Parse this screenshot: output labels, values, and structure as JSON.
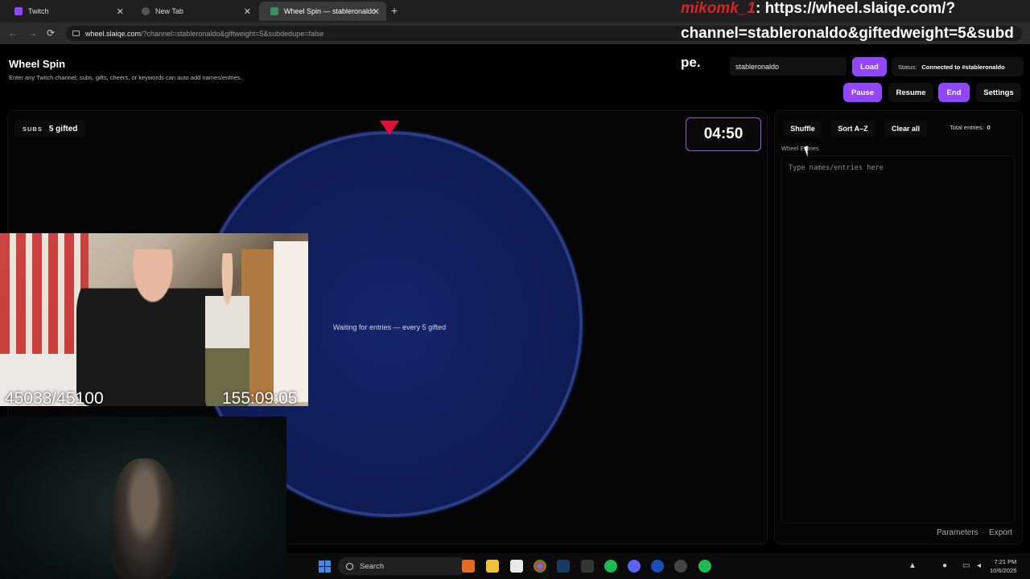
{
  "browser": {
    "tabs": [
      {
        "label": "Twitch",
        "active": false
      },
      {
        "label": "New Tab",
        "active": false
      },
      {
        "label": "Wheel Spin — stableronaldo",
        "active": true
      }
    ],
    "new_tab_symbol": "+",
    "close_symbol": "✕",
    "url_host": "wheel.slaiqe.com",
    "url_rest": "/?channel=stableronaldo&giftweight=5&subdedupe=false",
    "nav": {
      "back": "←",
      "forward": "→",
      "reload": "⟳"
    }
  },
  "overlay": {
    "username": "mikomk_1",
    "colon": ":",
    "url_line1": "https://wheel.slaiqe.com/?",
    "url_line2": "channel=stableronaldo&giftedweight=5&subd"
  },
  "app": {
    "title": "Wheel Spin",
    "subtitle": "Enter any Twitch channel; subs, gifts, cheers, or keywords can auto add names/entries.",
    "brand": "pe.",
    "channel_value": "stableronaldo",
    "load_label": "Load",
    "status_label": "Status:",
    "status_value": "Connected to #stableronaldo",
    "pause_label": "Pause",
    "resume_label": "Resume",
    "end_label": "End",
    "settings_label": "Settings"
  },
  "wheel": {
    "subs_label": "SUBS",
    "subs_value": "5 gifted",
    "timer": "04:50",
    "message": "Waiting for entries — every 5 gifted",
    "colors": {
      "wheel": "#0f1d5a",
      "rim": "#2b3c86",
      "pointer": "#e0103a",
      "accent": "#9147ff"
    }
  },
  "sidebar": {
    "shuffle_label": "Shuffle",
    "sort_label": "Sort A–Z",
    "clear_label": "Clear all",
    "total_label": "Total entries:",
    "total_value": "0",
    "entries_label": "Wheel Entries",
    "entries_placeholder": "Type names/entries here",
    "parameters_label": "Parameters",
    "separator": "·",
    "export_label": "Export"
  },
  "stream": {
    "sub_count": "45033/45100",
    "uptime": "155:09:05"
  },
  "taskbar": {
    "search_label": "Search",
    "time": "7:21 PM",
    "date": "10/6/2025",
    "apps": [
      "file-explorer",
      "store",
      "chrome",
      "steam",
      "epic",
      "spotify",
      "discord",
      "ccleaner",
      "obs",
      "spotify-2"
    ]
  }
}
